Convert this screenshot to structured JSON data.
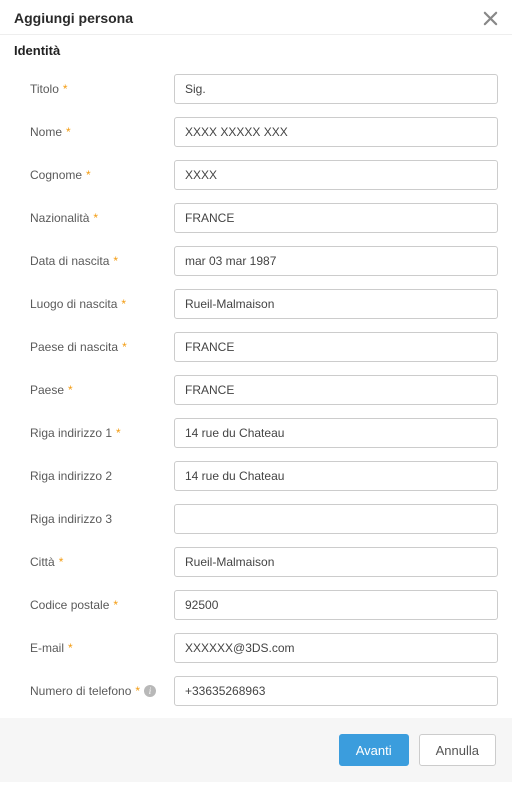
{
  "dialog": {
    "title": "Aggiungi persona",
    "section": "Identità"
  },
  "labels": {
    "titolo": "Titolo",
    "nome": "Nome",
    "cognome": "Cognome",
    "nazionalita": "Nazionalità",
    "data_nascita": "Data di nascita",
    "luogo_nascita": "Luogo di nascita",
    "paese_nascita": "Paese di nascita",
    "paese": "Paese",
    "riga1": "Riga indirizzo 1",
    "riga2": "Riga indirizzo 2",
    "riga3": "Riga indirizzo 3",
    "citta": "Città",
    "cap": "Codice postale",
    "email": "E-mail",
    "telefono": "Numero di telefono"
  },
  "values": {
    "titolo": "Sig.",
    "nome": "XXXX XXXXX XXX",
    "cognome": "XXXX",
    "nazionalita": "FRANCE",
    "data_nascita": "mar 03 mar 1987",
    "luogo_nascita": "Rueil-Malmaison",
    "paese_nascita": "FRANCE",
    "paese": "FRANCE",
    "riga1": "14 rue du Chateau",
    "riga2": "14 rue du Chateau",
    "riga3": "",
    "citta": "Rueil-Malmaison",
    "cap": "92500",
    "email": "XXXXXX@3DS.com",
    "telefono": "+33635268963"
  },
  "buttons": {
    "next": "Avanti",
    "cancel": "Annulla"
  }
}
